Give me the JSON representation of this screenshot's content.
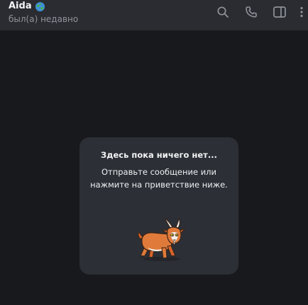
{
  "header": {
    "peer_name": "Aida",
    "peer_status": "был(а) недавно",
    "icons": [
      "search-icon",
      "phone-icon",
      "sidebar-icon",
      "more-icon"
    ]
  },
  "empty_chat": {
    "title": "Здесь пока ничего нет...",
    "line1": "Отправьте сообщение или",
    "line2": "нажмите на приветствие ниже."
  },
  "colors": {
    "background": "#18191d",
    "header": "#2a2c32",
    "card": "#2c2f35",
    "icon": "#8f9399",
    "sticker_fur": "#e07a3a"
  }
}
